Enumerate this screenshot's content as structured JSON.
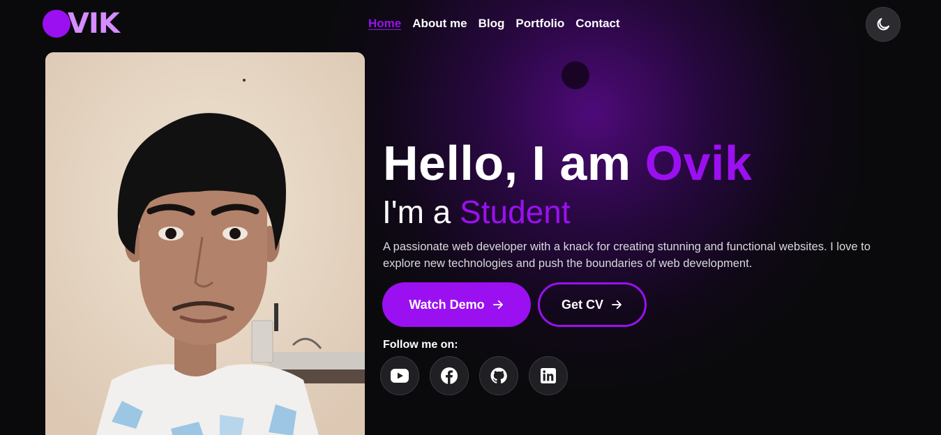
{
  "logo": {
    "text": "VIK"
  },
  "nav": {
    "items": [
      {
        "label": "Home",
        "active": true
      },
      {
        "label": "About me"
      },
      {
        "label": "Blog"
      },
      {
        "label": "Portfolio"
      },
      {
        "label": "Contact"
      }
    ]
  },
  "theme_toggle": {
    "icon": "moon-icon"
  },
  "photo": {
    "alt": "Portrait photo"
  },
  "hero": {
    "greeting": "Hello, I am",
    "name": "Ovik",
    "sub_prefix": "I'm a",
    "role": "Student",
    "description": "A passionate web developer with a knack for creating stunning and functional websites. I love to explore new technologies and push the boundaries of web development."
  },
  "buttons": {
    "watch_demo": "Watch Demo",
    "get_cv": "Get CV"
  },
  "social": {
    "label": "Follow me on:",
    "items": [
      {
        "icon": "youtube-icon"
      },
      {
        "icon": "facebook-icon"
      },
      {
        "icon": "github-icon"
      },
      {
        "icon": "linkedin-icon"
      }
    ]
  },
  "colors": {
    "accent": "#9b10f0",
    "logo_text": "#d58cff",
    "background": "#0a0a0c"
  }
}
